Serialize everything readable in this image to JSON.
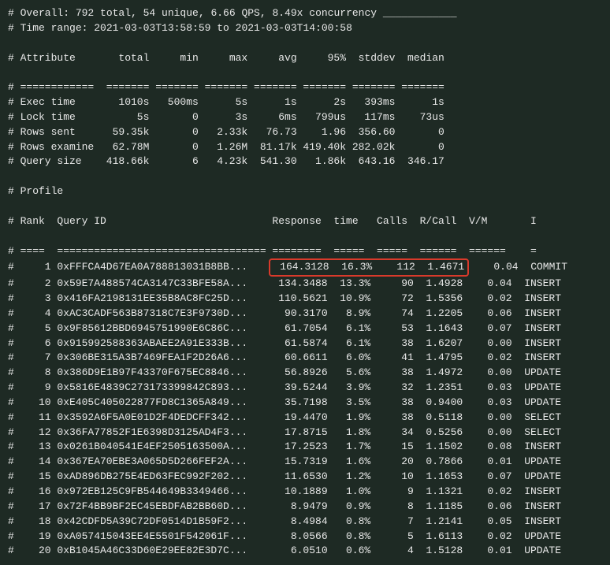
{
  "overall": "# Overall: 792 total, 54 unique, 6.66 QPS, 8.49x concurrency ____________",
  "timerange": "# Time range: 2021-03-03T13:58:59 to 2021-03-03T14:00:58",
  "summary_header": {
    "hash": "#",
    "attr": "Attribute",
    "total": "total",
    "min": "min",
    "max": "max",
    "avg": "avg",
    "p95": "95%",
    "stddev": "stddev",
    "median": "median"
  },
  "summary_sep": {
    "hash": "#",
    "attr": "============",
    "total": "=======",
    "min": "=======",
    "max": "=======",
    "avg": "=======",
    "p95": "=======",
    "stddev": "=======",
    "median": "======="
  },
  "summary_rows": [
    {
      "hash": "#",
      "attr": "Exec time",
      "total": "1010s",
      "min": "500ms",
      "max": "5s",
      "avg": "1s",
      "p95": "2s",
      "stddev": "393ms",
      "median": "1s"
    },
    {
      "hash": "#",
      "attr": "Lock time",
      "total": "5s",
      "min": "0",
      "max": "3s",
      "avg": "6ms",
      "p95": "799us",
      "stddev": "117ms",
      "median": "73us"
    },
    {
      "hash": "#",
      "attr": "Rows sent",
      "total": "59.35k",
      "min": "0",
      "max": "2.33k",
      "avg": "76.73",
      "p95": "1.96",
      "stddev": "356.60",
      "median": "0"
    },
    {
      "hash": "#",
      "attr": "Rows examine",
      "total": "62.78M",
      "min": "0",
      "max": "1.26M",
      "avg": "81.17k",
      "p95": "419.40k",
      "stddev": "282.02k",
      "median": "0"
    },
    {
      "hash": "#",
      "attr": "Query size",
      "total": "418.66k",
      "min": "6",
      "max": "4.23k",
      "avg": "541.30",
      "p95": "1.86k",
      "stddev": "643.16",
      "median": "346.17"
    }
  ],
  "profile_label": "# Profile",
  "profile_header": {
    "hash": "#",
    "rank": "Rank",
    "qid": "Query ID",
    "resp": "Response",
    "time": "time",
    "calls": "Calls",
    "rcall": "R/Call",
    "vm": "V/M",
    "i": "I"
  },
  "profile_sep": {
    "hash": "#",
    "rank": "====",
    "qid": "==================================",
    "rt": "========",
    "pct": "=====",
    "calls": "=====",
    "rcall": "======",
    "vm": "======",
    "i": "="
  },
  "profile_rows": [
    {
      "rank": "1",
      "qid": "0xFFFCA4D67EA0A788813031B8BB...",
      "rt": "164.3128",
      "pct": "16.3%",
      "calls": "112",
      "rcall": "1.4671",
      "vm": "0.04",
      "type": "COMMIT",
      "hl": true
    },
    {
      "rank": "2",
      "qid": "0x59E7A488574CA3147C33BFE58A...",
      "rt": "134.3488",
      "pct": "13.3%",
      "calls": "90",
      "rcall": "1.4928",
      "vm": "0.04",
      "type": "INSERT"
    },
    {
      "rank": "3",
      "qid": "0x416FA2198131EE35B8AC8FC25D...",
      "rt": "110.5621",
      "pct": "10.9%",
      "calls": "72",
      "rcall": "1.5356",
      "vm": "0.02",
      "type": "INSERT"
    },
    {
      "rank": "4",
      "qid": "0xAC3CADF563B87318C7E3F9730D...",
      "rt": "90.3170",
      "pct": "8.9%",
      "calls": "74",
      "rcall": "1.2205",
      "vm": "0.06",
      "type": "INSERT"
    },
    {
      "rank": "5",
      "qid": "0x9F85612BBD6945751990E6C86C...",
      "rt": "61.7054",
      "pct": "6.1%",
      "calls": "53",
      "rcall": "1.1643",
      "vm": "0.07",
      "type": "INSERT"
    },
    {
      "rank": "6",
      "qid": "0x915992588363ABAEE2A91E333B...",
      "rt": "61.5874",
      "pct": "6.1%",
      "calls": "38",
      "rcall": "1.6207",
      "vm": "0.00",
      "type": "INSERT"
    },
    {
      "rank": "7",
      "qid": "0x306BE315A3B7469FEA1F2D26A6...",
      "rt": "60.6611",
      "pct": "6.0%",
      "calls": "41",
      "rcall": "1.4795",
      "vm": "0.02",
      "type": "INSERT"
    },
    {
      "rank": "8",
      "qid": "0x386D9E1B97F43370F675EC8846...",
      "rt": "56.8926",
      "pct": "5.6%",
      "calls": "38",
      "rcall": "1.4972",
      "vm": "0.00",
      "type": "UPDATE"
    },
    {
      "rank": "9",
      "qid": "0x5816E4839C273173399842C893...",
      "rt": "39.5244",
      "pct": "3.9%",
      "calls": "32",
      "rcall": "1.2351",
      "vm": "0.03",
      "type": "UPDATE"
    },
    {
      "rank": "10",
      "qid": "0xE405C405022877FD8C1365A849...",
      "rt": "35.7198",
      "pct": "3.5%",
      "calls": "38",
      "rcall": "0.9400",
      "vm": "0.03",
      "type": "UPDATE"
    },
    {
      "rank": "11",
      "qid": "0x3592A6F5A0E01D2F4DEDCFF342...",
      "rt": "19.4470",
      "pct": "1.9%",
      "calls": "38",
      "rcall": "0.5118",
      "vm": "0.00",
      "type": "SELECT"
    },
    {
      "rank": "12",
      "qid": "0x36FA77852F1E6398D3125AD4F3...",
      "rt": "17.8715",
      "pct": "1.8%",
      "calls": "34",
      "rcall": "0.5256",
      "vm": "0.00",
      "type": "SELECT"
    },
    {
      "rank": "13",
      "qid": "0x0261B040541E4EF2505163500A...",
      "rt": "17.2523",
      "pct": "1.7%",
      "calls": "15",
      "rcall": "1.1502",
      "vm": "0.08",
      "type": "INSERT"
    },
    {
      "rank": "14",
      "qid": "0x367EA70EBE3A065D5D266FEF2A...",
      "rt": "15.7319",
      "pct": "1.6%",
      "calls": "20",
      "rcall": "0.7866",
      "vm": "0.01",
      "type": "UPDATE"
    },
    {
      "rank": "15",
      "qid": "0xAD896DB275E4ED63FEC992F202...",
      "rt": "11.6530",
      "pct": "1.2%",
      "calls": "10",
      "rcall": "1.1653",
      "vm": "0.07",
      "type": "UPDATE"
    },
    {
      "rank": "16",
      "qid": "0x972EB125C9FB544649B3349466...",
      "rt": "10.1889",
      "pct": "1.0%",
      "calls": "9",
      "rcall": "1.1321",
      "vm": "0.02",
      "type": "INSERT"
    },
    {
      "rank": "17",
      "qid": "0x72F4BB9BF2EC45EBDFAB2BB60D...",
      "rt": "8.9479",
      "pct": "0.9%",
      "calls": "8",
      "rcall": "1.1185",
      "vm": "0.06",
      "type": "INSERT"
    },
    {
      "rank": "18",
      "qid": "0x42CDFD5A39C72DF0514D1B59F2...",
      "rt": "8.4984",
      "pct": "0.8%",
      "calls": "7",
      "rcall": "1.2141",
      "vm": "0.05",
      "type": "INSERT"
    },
    {
      "rank": "19",
      "qid": "0xA057415043EE4E5501F542061F...",
      "rt": "8.0566",
      "pct": "0.8%",
      "calls": "5",
      "rcall": "1.6113",
      "vm": "0.02",
      "type": "UPDATE"
    },
    {
      "rank": "20",
      "qid": "0xB1045A46C33D60E29EE82E3D7C...",
      "rt": "6.0510",
      "pct": "0.6%",
      "calls": "4",
      "rcall": "1.5128",
      "vm": "0.01",
      "type": "UPDATE"
    }
  ]
}
